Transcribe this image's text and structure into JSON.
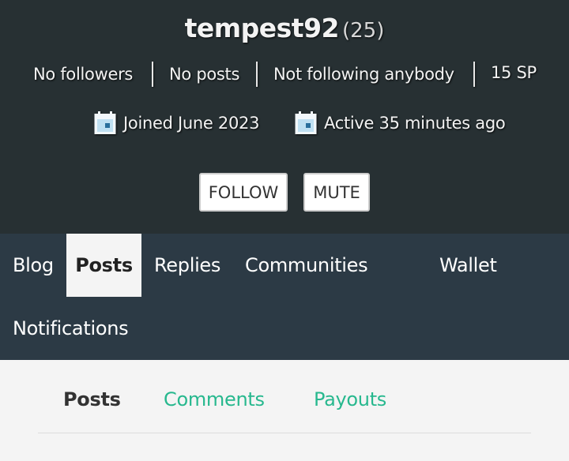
{
  "profile": {
    "username": "tempest92",
    "reputation": "(25)",
    "stats": {
      "followers": "No followers",
      "posts": "No posts",
      "following": "Not following anybody",
      "sp": "15 SP"
    },
    "joined": "Joined June 2023",
    "active": "Active 35 minutes ago"
  },
  "actions": {
    "follow_label": "FOLLOW",
    "mute_label": "MUTE"
  },
  "nav": {
    "blog": "Blog",
    "posts": "Posts",
    "replies": "Replies",
    "communities": "Communities",
    "wallet": "Wallet",
    "notifications": "Notifications"
  },
  "subtabs": {
    "posts": "Posts",
    "comments": "Comments",
    "payouts": "Payouts"
  },
  "colors": {
    "header_bg": "#273033",
    "nav_bg": "#2c3a45",
    "accent_green": "#27b88e",
    "icon_bg": "#bfe0f2",
    "icon_frame": "#f2f7fb",
    "icon_mark": "#2a6f9c"
  },
  "icons": {
    "joined": "calendar-icon",
    "active": "calendar-icon"
  }
}
